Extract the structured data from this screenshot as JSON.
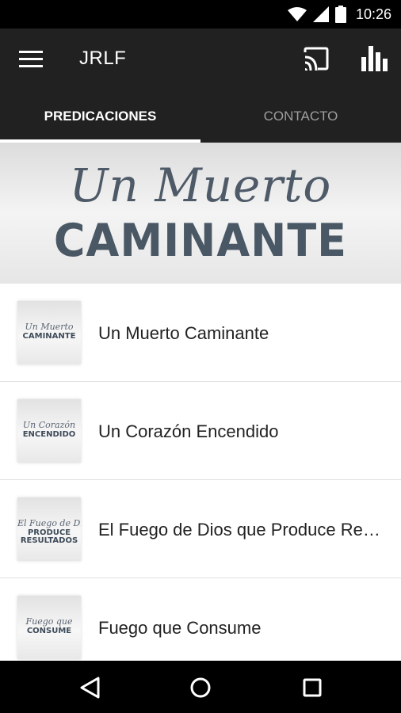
{
  "status_bar": {
    "time": "10:26",
    "icons": [
      "wifi-icon",
      "signal-icon",
      "battery-icon"
    ]
  },
  "app_bar": {
    "title": "JRLF",
    "icons": [
      "menu-icon",
      "cast-icon",
      "bar-chart-icon"
    ]
  },
  "tabs": [
    {
      "label": "PREDICACIONES",
      "active": true
    },
    {
      "label": "CONTACTO",
      "active": false
    }
  ],
  "banner": {
    "script_text": "Un Muerto",
    "main_text": "CAMINANTE"
  },
  "sermons": [
    {
      "title": "Un Muerto Caminante",
      "thumb_script": "Un Muerto",
      "thumb_main": "CAMINANTE"
    },
    {
      "title": "Un Corazón Encendido",
      "thumb_script": "Un Corazón",
      "thumb_main": "ENCENDIDO"
    },
    {
      "title": "El Fuego de Dios que Produce Resultados",
      "thumb_script": "El Fuego de Dios",
      "thumb_main": "PRODUCE RESULTADOS"
    },
    {
      "title": "Fuego que Consume",
      "thumb_script": "Fuego que",
      "thumb_main": "CONSUME"
    }
  ],
  "nav_bar": {
    "icons": [
      "back-icon",
      "home-icon",
      "recents-icon"
    ]
  },
  "colors": {
    "app_bar": "#212121",
    "status_bar": "#000000",
    "banner_text": "#4a5866"
  }
}
